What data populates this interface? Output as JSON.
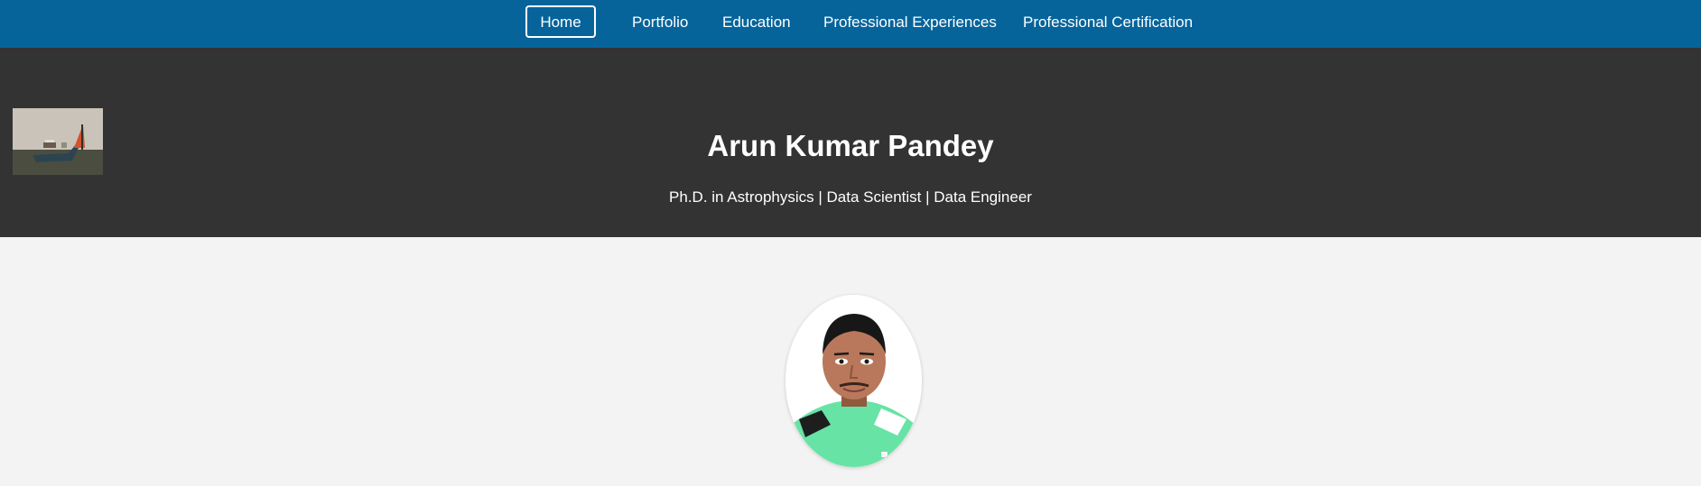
{
  "nav": {
    "items": [
      {
        "label": "Home",
        "active": true
      },
      {
        "label": "Portfolio",
        "active": false
      },
      {
        "label": "Education",
        "active": false
      },
      {
        "label": "Professional Experiences",
        "active": false
      },
      {
        "label": "Professional Certification",
        "active": false
      }
    ]
  },
  "hero": {
    "name": "Arun Kumar Pandey",
    "tagline": "Ph.D. in Astrophysics | Data Scientist | Data Engineer"
  },
  "colors": {
    "nav_background": "#06649b",
    "hero_background": "#333333",
    "page_background": "#f3f3f3",
    "text_on_dark": "#ffffff"
  },
  "icons": {
    "logo": "ship-logo-icon",
    "profile": "profile-photo"
  }
}
